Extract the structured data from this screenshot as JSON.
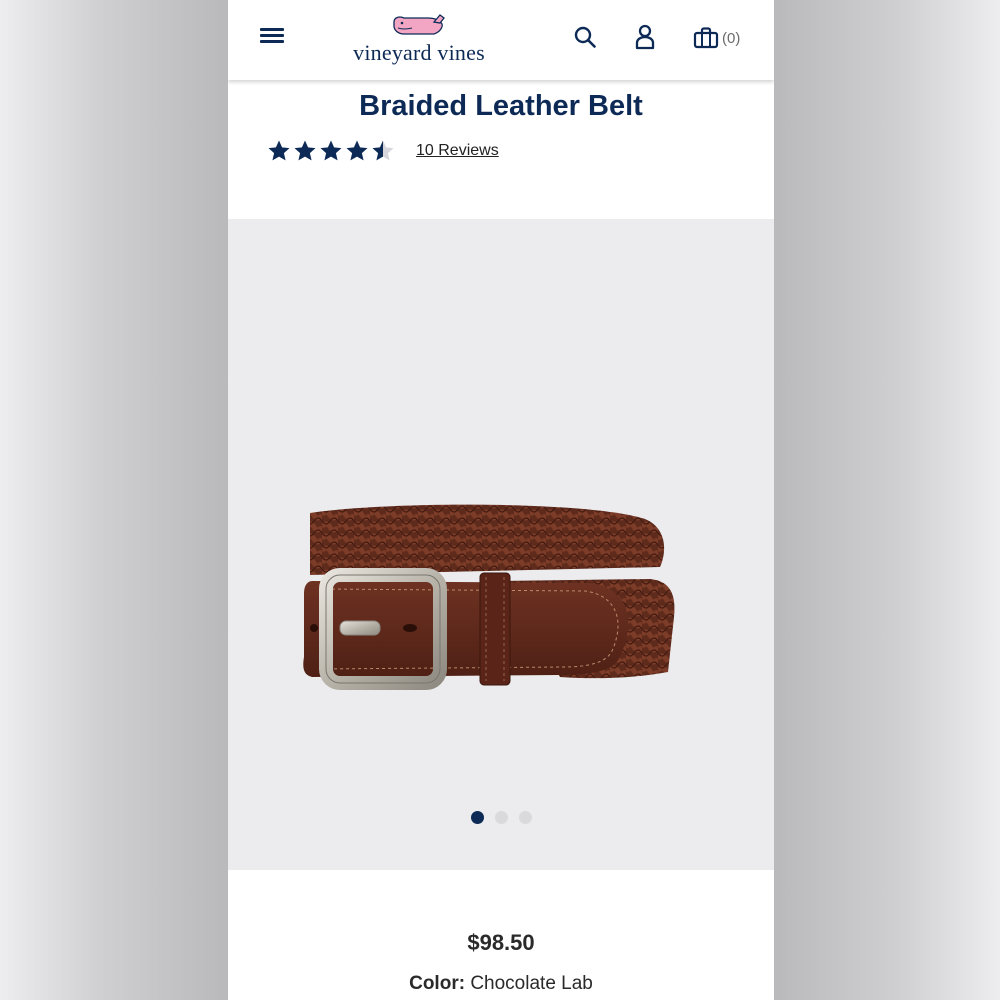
{
  "brand": {
    "name": "vineyard vines",
    "accent": "#0d2a56",
    "whale_color": "#f3a6c4"
  },
  "header": {
    "icons": [
      "menu-icon",
      "search-icon",
      "account-icon",
      "shopping-bag-icon"
    ],
    "bag_count": "(0)"
  },
  "product": {
    "title": "Braided Leather Belt",
    "rating_stars": 4.5,
    "reviews_text": "10 Reviews",
    "price": "$98.50",
    "color_label": "Color:",
    "color_value": "Chocolate Lab"
  },
  "gallery": {
    "image_count": 3,
    "active_index": 1
  }
}
